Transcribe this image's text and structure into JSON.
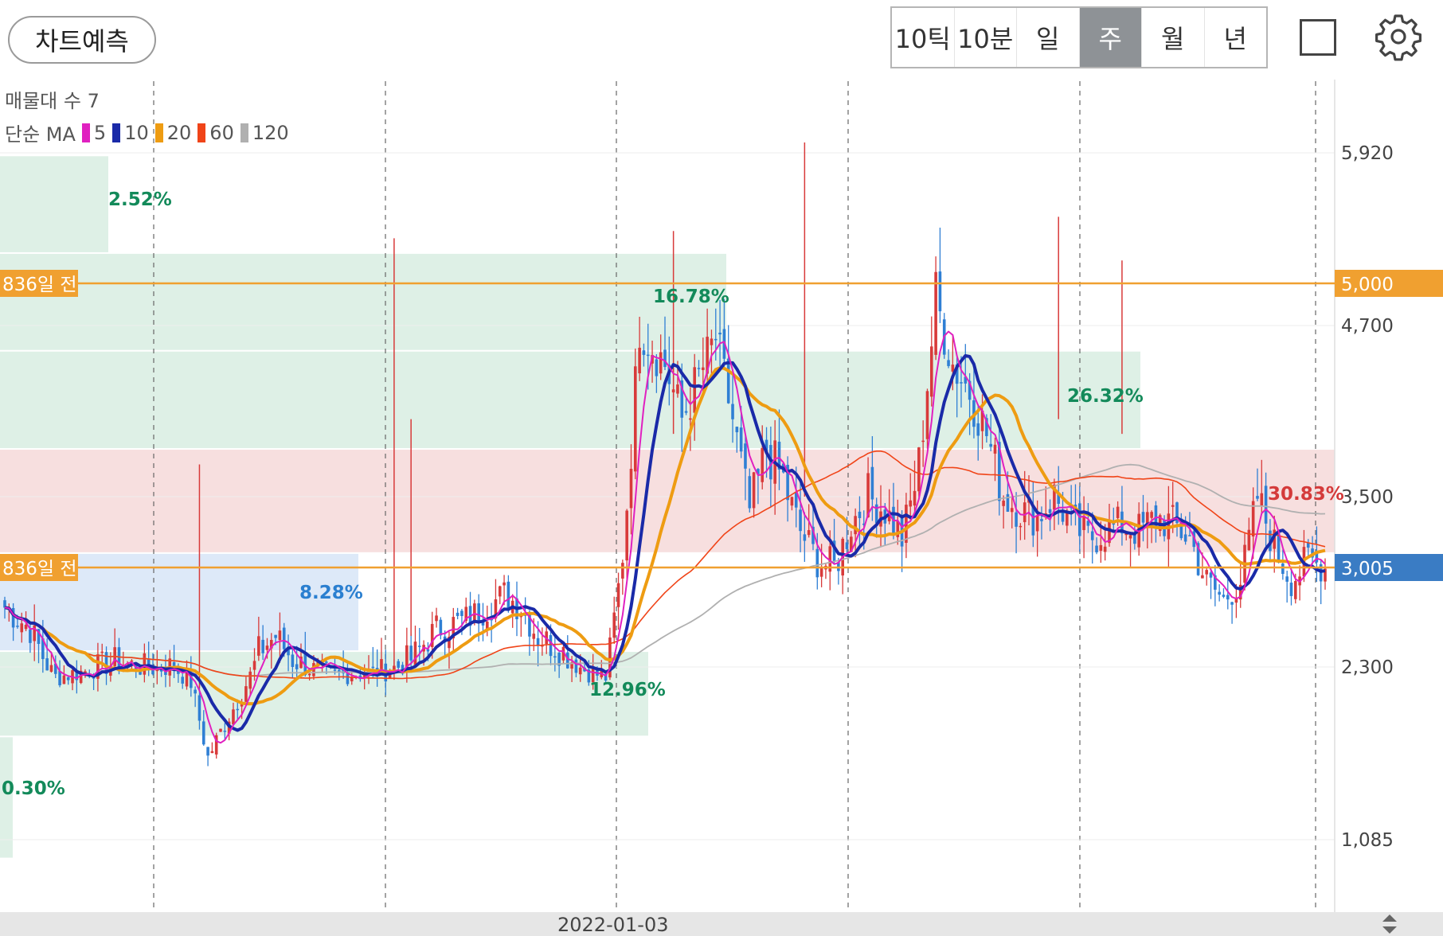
{
  "header": {
    "predict_label": "차트예측",
    "period_tabs": [
      "10틱",
      "10분",
      "일",
      "주",
      "월",
      "년"
    ],
    "active_tab": "주",
    "icons": [
      "square-icon",
      "gear-icon"
    ]
  },
  "legend": {
    "volume_profile": "매물대 수 7",
    "ma_prefix": "단순 MA",
    "ma_items": [
      {
        "label": "5",
        "color": "#e020c0"
      },
      {
        "label": "10",
        "color": "#1a2aa8"
      },
      {
        "label": "20",
        "color": "#ee9c12"
      },
      {
        "label": "60",
        "color": "#f04418"
      },
      {
        "label": "120",
        "color": "#b0b0b0"
      }
    ]
  },
  "x_axis": {
    "date_label": "2022-01-03"
  },
  "chart_data": {
    "type": "candlestick",
    "y_axis_ticks": [
      "5,920",
      "4,700",
      "3,500",
      "2,300",
      "1,085"
    ],
    "price_lines": [
      {
        "label": "836일 전",
        "value_label": "5,000",
        "color": "#f0a030"
      },
      {
        "label": "836일 전",
        "value_label": "3,005",
        "color": "#f0a030"
      }
    ],
    "current_price_label": "3,005",
    "current_price_color": "#3a7cc4",
    "volume_profile_zones": [
      {
        "percent": "2.52%",
        "price_range": [
          5200,
          5900
        ],
        "color": "#def0e6",
        "text_color": "#138a5a"
      },
      {
        "percent": "16.78%",
        "price_range": [
          4500,
          5200
        ],
        "color": "#def0e6",
        "text_color": "#138a5a"
      },
      {
        "percent": "26.32%",
        "price_range": [
          3800,
          4500
        ],
        "color": "#def0e6",
        "text_color": "#138a5a"
      },
      {
        "percent": "30.83%",
        "price_range": [
          3100,
          3800
        ],
        "color": "#f7dfdf",
        "text_color": "#d43a3a"
      },
      {
        "percent": "8.28%",
        "price_range": [
          2400,
          3100
        ],
        "color": "#dde9f8",
        "text_color": "#2a7fd0"
      },
      {
        "percent": "12.96%",
        "price_range": [
          1700,
          2400
        ],
        "color": "#def0e6",
        "text_color": "#138a5a"
      },
      {
        "percent": "0.30%",
        "price_range": [
          1000,
          1700
        ],
        "color": "#def0e6",
        "text_color": "#138a5a"
      }
    ],
    "ma_lines_drawn": [
      "5",
      "10",
      "20",
      "60",
      "120"
    ],
    "up_color": "#d83a3a",
    "down_color": "#2f7fd4",
    "ylim": [
      900,
      6200
    ]
  }
}
